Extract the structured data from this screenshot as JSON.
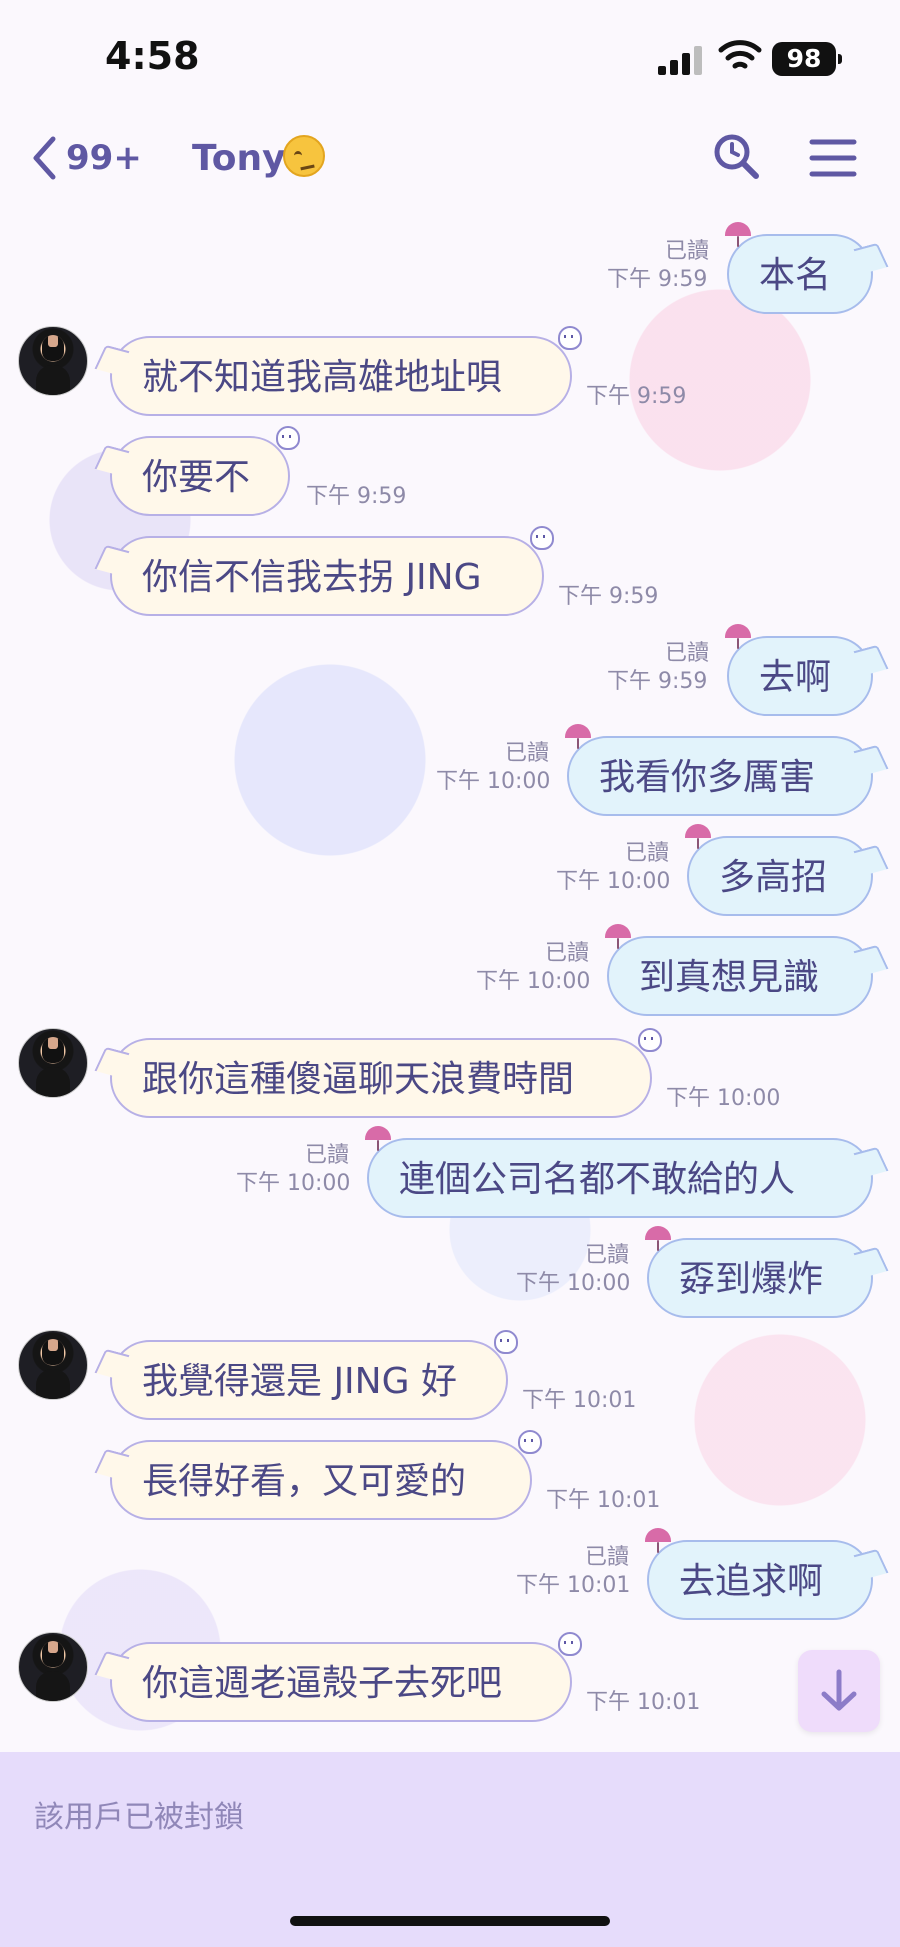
{
  "status_bar": {
    "time": "4:58",
    "battery": "98"
  },
  "header": {
    "back_count": "99+",
    "title": "Tony",
    "title_emoji": "woozy-face-icon"
  },
  "messages": [
    {
      "text": "本名",
      "read": "已讀",
      "time": "下午 9:59"
    },
    {
      "text": "就不知道我高雄地址唄",
      "time": "下午 9:59"
    },
    {
      "text": "你要不",
      "time": "下午 9:59"
    },
    {
      "text": "你信不信我去拐 JING",
      "time": "下午 9:59"
    },
    {
      "text": "去啊",
      "read": "已讀",
      "time": "下午 9:59"
    },
    {
      "text": "我看你多厲害",
      "read": "已讀",
      "time": "下午 10:00"
    },
    {
      "text": "多高招",
      "read": "已讀",
      "time": "下午 10:00"
    },
    {
      "text": "到真想見識",
      "read": "已讀",
      "time": "下午 10:00"
    },
    {
      "text": "跟你這種傻逼聊天浪費時間",
      "time": "下午 10:00"
    },
    {
      "text": "連個公司名都不敢給的人",
      "read": "已讀",
      "time": "下午 10:00"
    },
    {
      "text": "孬到爆炸",
      "read": "已讀",
      "time": "下午 10:00"
    },
    {
      "text": "我覺得還是 JING 好",
      "time": "下午 10:01"
    },
    {
      "text": "長得好看，又可愛的",
      "time": "下午 10:01"
    },
    {
      "text": "去追求啊",
      "read": "已讀",
      "time": "下午 10:01"
    },
    {
      "text": "你這週老逼殼子去死吧",
      "time": "下午 10:01"
    }
  ],
  "footer": {
    "blocked_notice": "該用戶已被封鎖"
  },
  "colors": {
    "accent": "#5f58a3",
    "incoming_bubble": "#fff8ea",
    "outgoing_bubble": "#e2f3fb",
    "footer_bg": "#e6dcfb"
  }
}
